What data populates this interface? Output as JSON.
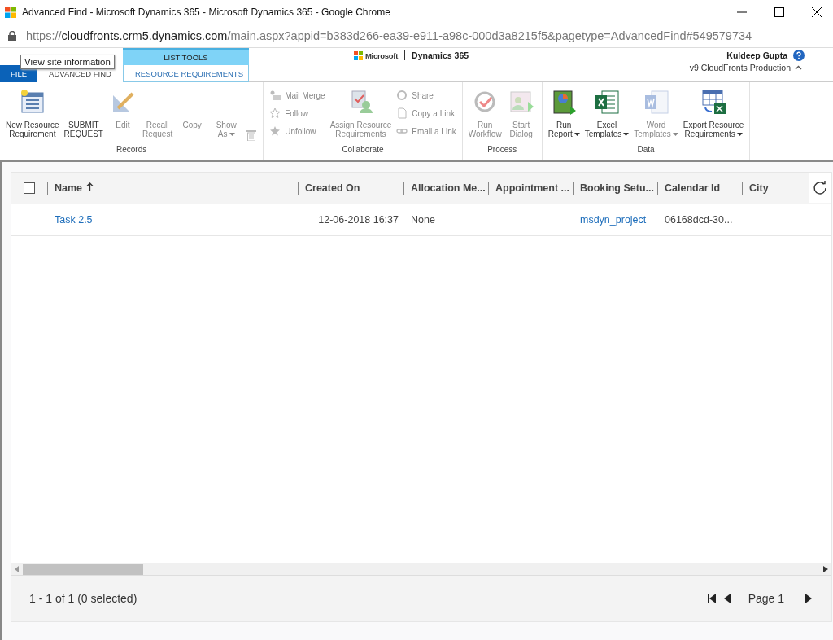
{
  "window": {
    "title": "Advanced Find - Microsoft Dynamics 365 - Microsoft Dynamics 365 - Google Chrome"
  },
  "address_bar": {
    "scheme": "https://",
    "host": "cloudfronts.crm5.dynamics.com",
    "path": "/main.aspx?appid=b383d266-ea39-e911-a98c-000d3a8215f5&pagetype=AdvancedFind#549579734"
  },
  "tooltip": "View site information",
  "brand": {
    "company": "Microsoft",
    "product": "Dynamics 365"
  },
  "user": {
    "name": "Kuldeep Gupta",
    "org": "v9 CloudFronts Production"
  },
  "contextual_group": "LIST TOOLS",
  "tabs": [
    {
      "label": "FILE",
      "kind": "file",
      "selected": false
    },
    {
      "label": "ADVANCED FIND",
      "kind": "plain",
      "selected": false
    },
    {
      "label": "RESOURCE REQUIREMENTS",
      "kind": "contextual",
      "selected": true
    }
  ],
  "ribbon_groups": [
    {
      "label": "Records",
      "buttons": [
        {
          "kind": "large",
          "label": "New Resource Requirement",
          "disabled": false
        },
        {
          "kind": "text",
          "label": "SUBMIT REQUEST",
          "disabled": false
        },
        {
          "kind": "large",
          "label": "Edit",
          "disabled": true
        },
        {
          "kind": "text",
          "label": "Recall Request",
          "disabled": true
        },
        {
          "kind": "text",
          "label": "Copy",
          "disabled": true
        },
        {
          "kind": "text",
          "label": "Show As",
          "disabled": true,
          "dropdown": true
        },
        {
          "kind": "icon",
          "disabled": true
        }
      ]
    },
    {
      "label": "Collaborate",
      "buttons": [
        {
          "kind": "stack",
          "items": [
            {
              "label": "Mail Merge",
              "disabled": true
            },
            {
              "label": "Follow",
              "disabled": true
            },
            {
              "label": "Unfollow",
              "disabled": true
            }
          ]
        },
        {
          "kind": "large",
          "label": "Assign Resource Requirements",
          "disabled": true
        },
        {
          "kind": "stack",
          "items": [
            {
              "label": "Share",
              "disabled": true
            },
            {
              "label": "Copy a Link",
              "disabled": true
            },
            {
              "label": "Email a Link",
              "disabled": true
            }
          ]
        }
      ]
    },
    {
      "label": "Process",
      "buttons": [
        {
          "kind": "large",
          "label": "Run Workflow",
          "disabled": true
        },
        {
          "kind": "large",
          "label": "Start Dialog",
          "disabled": true
        }
      ]
    },
    {
      "label": "Data",
      "buttons": [
        {
          "kind": "large",
          "label": "Run Report",
          "disabled": false,
          "dropdown": true
        },
        {
          "kind": "large",
          "label": "Excel Templates",
          "disabled": false,
          "dropdown": true
        },
        {
          "kind": "large",
          "label": "Word Templates",
          "disabled": true,
          "dropdown": true
        },
        {
          "kind": "large",
          "label": "Export Resource Requirements",
          "disabled": false,
          "dropdown": true
        }
      ]
    }
  ],
  "table": {
    "all_selected": false,
    "columns": [
      {
        "label": "Name",
        "sorted": true
      },
      {
        "label": "Created On",
        "sorted": false
      },
      {
        "label": "Allocation Me...",
        "sorted": false
      },
      {
        "label": "Appointment ...",
        "sorted": false
      },
      {
        "label": "Booking Setu...",
        "sorted": false
      },
      {
        "label": "Calendar Id",
        "sorted": false
      },
      {
        "label": "City",
        "sorted": false
      }
    ],
    "rows": [
      {
        "selected": false,
        "cells": [
          {
            "text": "Task 2.5",
            "kind": "link"
          },
          {
            "text": "12-06-2018 16:37",
            "kind": "date"
          },
          {
            "text": "None",
            "kind": "text"
          },
          {
            "kind": "empty"
          },
          {
            "text": "msdyn_project",
            "kind": "link"
          },
          {
            "text": "06168dcd-30...",
            "kind": "text"
          },
          {
            "kind": "empty"
          }
        ]
      }
    ]
  },
  "status_bar": {
    "count": "1 - 1 of 1 (0 selected)",
    "page": "Page 1"
  }
}
